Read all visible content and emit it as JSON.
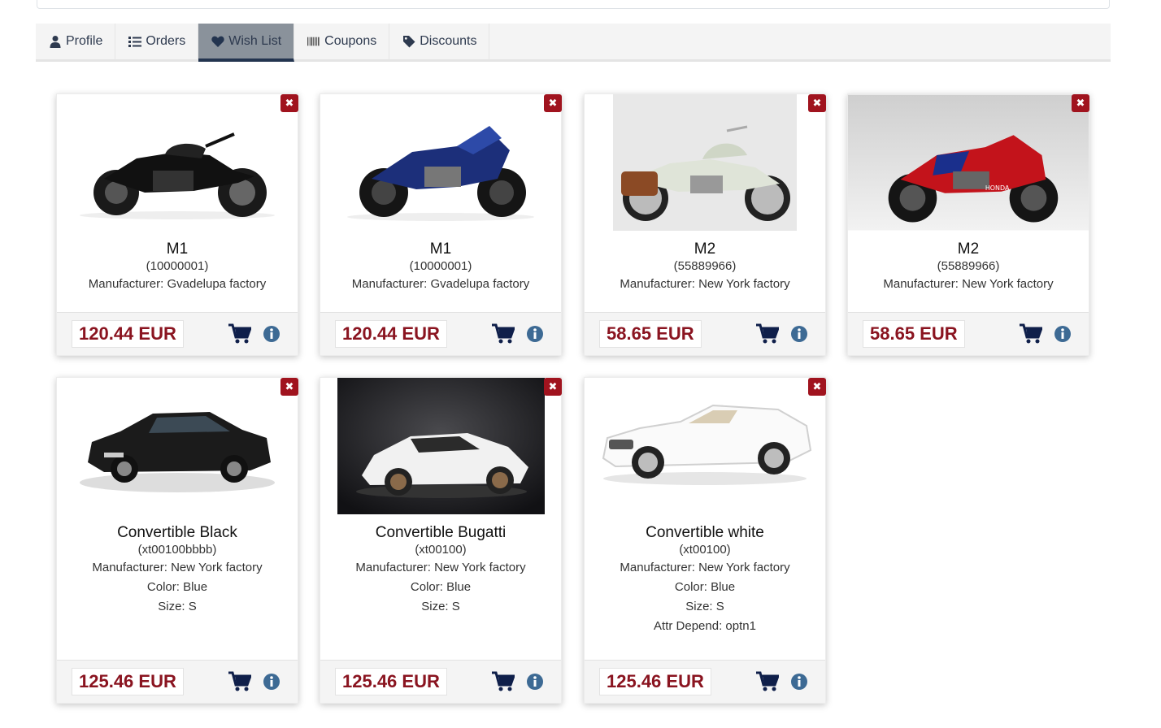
{
  "tabs": [
    {
      "label": "Profile",
      "icon": "user-icon"
    },
    {
      "label": "Orders",
      "icon": "list-icon"
    },
    {
      "label": "Wish List",
      "icon": "heart-icon",
      "active": true
    },
    {
      "label": "Coupons",
      "icon": "barcode-icon"
    },
    {
      "label": "Discounts",
      "icon": "tag-icon"
    }
  ],
  "colors": {
    "accent": "#a0131e",
    "price": "#8a1420",
    "nav": "#23344f",
    "info": "#3d6a94"
  },
  "cards": [
    {
      "name": "M1",
      "sku": "(10000001)",
      "manufacturer": "Manufacturer: Gvadelupa factory",
      "price": "120.44 EUR"
    },
    {
      "name": "M1",
      "sku": "(10000001)",
      "manufacturer": "Manufacturer: Gvadelupa factory",
      "price": "120.44 EUR"
    },
    {
      "name": "M2",
      "sku": "(55889966)",
      "manufacturer": "Manufacturer: New York factory",
      "price": "58.65 EUR"
    },
    {
      "name": "M2",
      "sku": "(55889966)",
      "manufacturer": "Manufacturer: New York factory",
      "price": "58.65 EUR"
    },
    {
      "name": "Convertible Black",
      "sku": "(xt00100bbbb)",
      "manufacturer": "Manufacturer: New York factory",
      "color": "Color: Blue",
      "size": "Size: S",
      "price": "125.46 EUR"
    },
    {
      "name": "Convertible Bugatti",
      "sku": "(xt00100)",
      "manufacturer": "Manufacturer: New York factory",
      "color": "Color: Blue",
      "size": "Size: S",
      "price": "125.46 EUR"
    },
    {
      "name": "Convertible white",
      "sku": "(xt00100)",
      "manufacturer": "Manufacturer: New York factory",
      "color": "Color: Blue",
      "size": "Size: S",
      "attr": "Attr Depend: optn1",
      "price": "125.46 EUR"
    }
  ]
}
